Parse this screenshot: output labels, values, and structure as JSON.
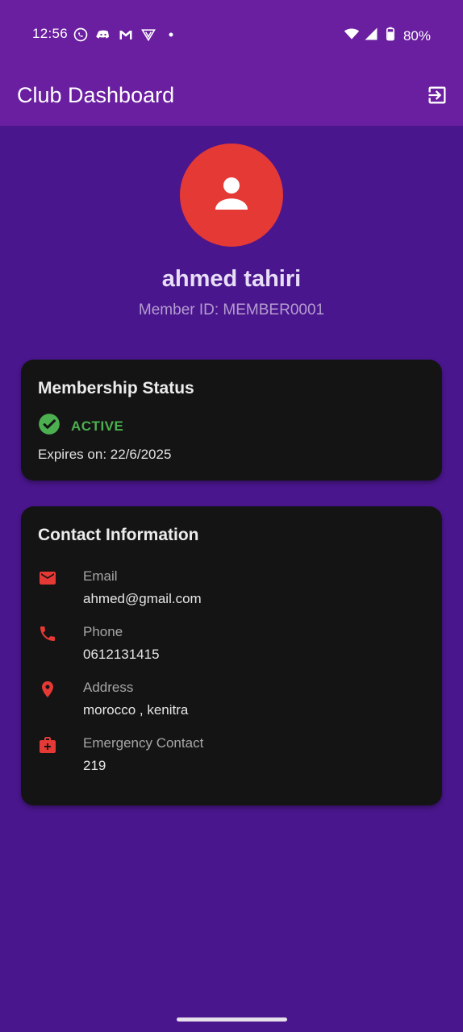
{
  "status_bar": {
    "time": "12:56",
    "battery": "80%",
    "icons": [
      "whatsapp-icon",
      "discord-icon",
      "gmail-icon",
      "vpn-icon",
      "dot-icon",
      "wifi-icon",
      "signal-icon",
      "battery-icon"
    ]
  },
  "app_bar": {
    "title": "Club Dashboard",
    "action_icon": "logout-icon"
  },
  "profile": {
    "name": "ahmed tahiri",
    "member_id": "Member ID: MEMBER0001",
    "avatar_icon": "person-icon"
  },
  "membership": {
    "title": "Membership Status",
    "status": "ACTIVE",
    "expires": "Expires on: 22/6/2025",
    "status_icon": "check-circle-icon"
  },
  "contact": {
    "title": "Contact Information",
    "items": [
      {
        "label": "Email",
        "value": "ahmed@gmail.com",
        "icon": "email-icon"
      },
      {
        "label": "Phone",
        "value": "0612131415",
        "icon": "phone-icon"
      },
      {
        "label": "Address",
        "value": "morocco , kenitra",
        "icon": "location-icon"
      },
      {
        "label": "Emergency Contact",
        "value": "219",
        "icon": "medical-kit-icon"
      }
    ]
  },
  "colors": {
    "background": "#4a168d",
    "app_bar": "#6a1ea0",
    "card": "#141414",
    "accent_red": "#e53935",
    "active_green": "#4caf50"
  }
}
